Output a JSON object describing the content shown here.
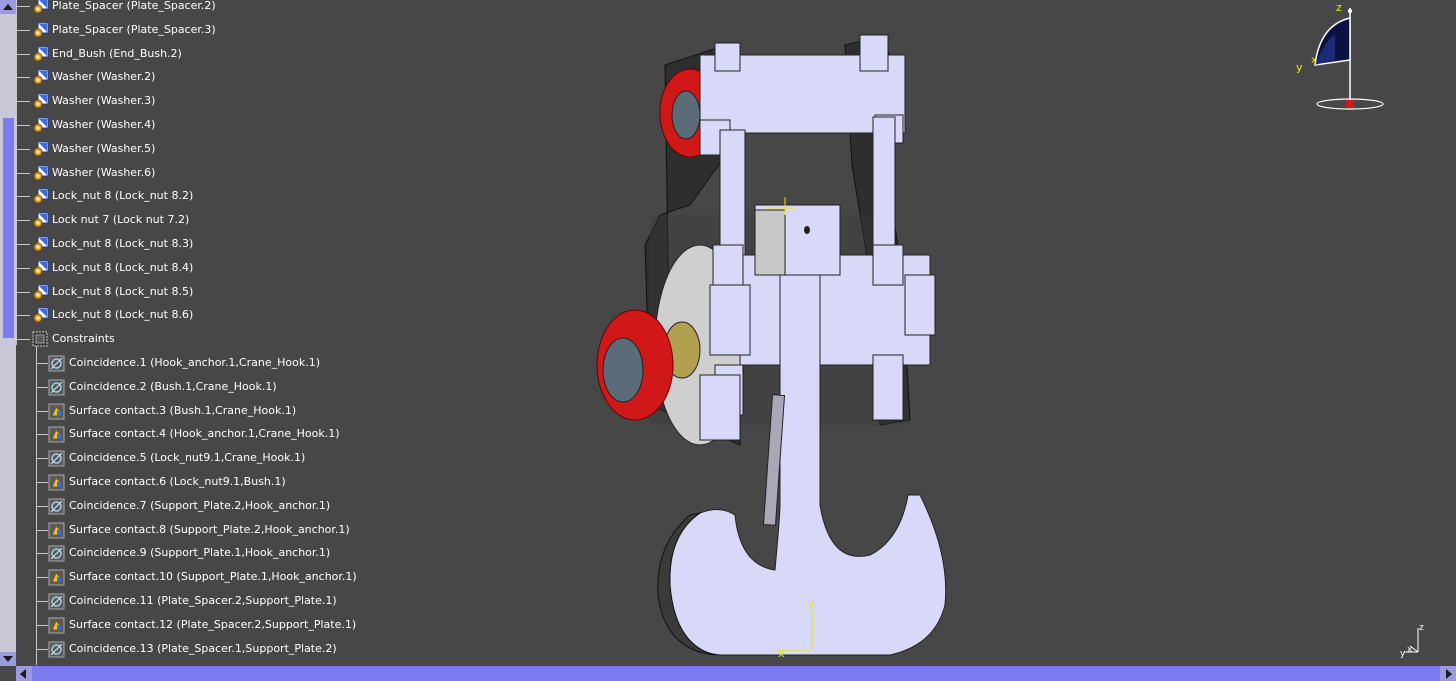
{
  "tree": {
    "assembly_items": [
      {
        "label": "Plate_Spacer (Plate_Spacer.2)",
        "icon": "part-instance-icon"
      },
      {
        "label": "Plate_Spacer (Plate_Spacer.3)",
        "icon": "part-instance-icon"
      },
      {
        "label": "End_Bush (End_Bush.2)",
        "icon": "part-instance-icon"
      },
      {
        "label": "Washer (Washer.2)",
        "icon": "part-instance-icon"
      },
      {
        "label": "Washer (Washer.3)",
        "icon": "part-instance-icon"
      },
      {
        "label": "Washer (Washer.4)",
        "icon": "part-instance-icon"
      },
      {
        "label": "Washer (Washer.5)",
        "icon": "part-instance-icon"
      },
      {
        "label": "Washer (Washer.6)",
        "icon": "part-instance-icon"
      },
      {
        "label": "Lock_nut 8 (Lock_nut 8.2)",
        "icon": "part-instance-icon"
      },
      {
        "label": "Lock nut 7 (Lock nut 7.2)",
        "icon": "part-instance-icon"
      },
      {
        "label": "Lock_nut 8 (Lock_nut 8.3)",
        "icon": "part-instance-icon"
      },
      {
        "label": "Lock_nut 8 (Lock_nut 8.4)",
        "icon": "part-instance-icon"
      },
      {
        "label": "Lock_nut 8 (Lock_nut 8.5)",
        "icon": "part-instance-icon"
      },
      {
        "label": "Lock_nut 8 (Lock_nut 8.6)",
        "icon": "part-instance-icon"
      }
    ],
    "constraints_label": "Constraints",
    "constraints": [
      {
        "label": "Coincidence.1 (Hook_anchor.1,Crane_Hook.1)",
        "icon": "coincidence-icon"
      },
      {
        "label": "Coincidence.2 (Bush.1,Crane_Hook.1)",
        "icon": "coincidence-icon"
      },
      {
        "label": "Surface contact.3 (Bush.1,Crane_Hook.1)",
        "icon": "surface-contact-icon"
      },
      {
        "label": "Surface contact.4 (Hook_anchor.1,Crane_Hook.1)",
        "icon": "surface-contact-icon"
      },
      {
        "label": "Coincidence.5 (Lock_nut9.1,Crane_Hook.1)",
        "icon": "coincidence-icon"
      },
      {
        "label": "Surface contact.6 (Lock_nut9.1,Bush.1)",
        "icon": "surface-contact-icon"
      },
      {
        "label": "Coincidence.7 (Support_Plate.2,Hook_anchor.1)",
        "icon": "coincidence-icon"
      },
      {
        "label": "Surface contact.8 (Support_Plate.2,Hook_anchor.1)",
        "icon": "surface-contact-icon"
      },
      {
        "label": "Coincidence.9 (Support_Plate.1,Hook_anchor.1)",
        "icon": "coincidence-icon"
      },
      {
        "label": "Surface contact.10 (Support_Plate.1,Hook_anchor.1)",
        "icon": "surface-contact-icon"
      },
      {
        "label": "Coincidence.11 (Plate_Spacer.2,Support_Plate.1)",
        "icon": "coincidence-icon"
      },
      {
        "label": "Surface contact.12 (Plate_Spacer.2,Support_Plate.1)",
        "icon": "surface-contact-icon"
      },
      {
        "label": "Coincidence.13 (Plate_Spacer.1,Support_Plate.2)",
        "icon": "coincidence-icon"
      }
    ]
  },
  "compass": {
    "z": "z",
    "y": "y",
    "x": "x"
  },
  "axis_mini": {
    "x": "x",
    "y": "y",
    "z": "z"
  },
  "model_axis": {
    "y": "y",
    "x": "x"
  },
  "colors": {
    "background": "#474747",
    "part_face": "#d8d8f8",
    "nut_red": "#d81818",
    "scrollbar": "#7c7cf0"
  }
}
